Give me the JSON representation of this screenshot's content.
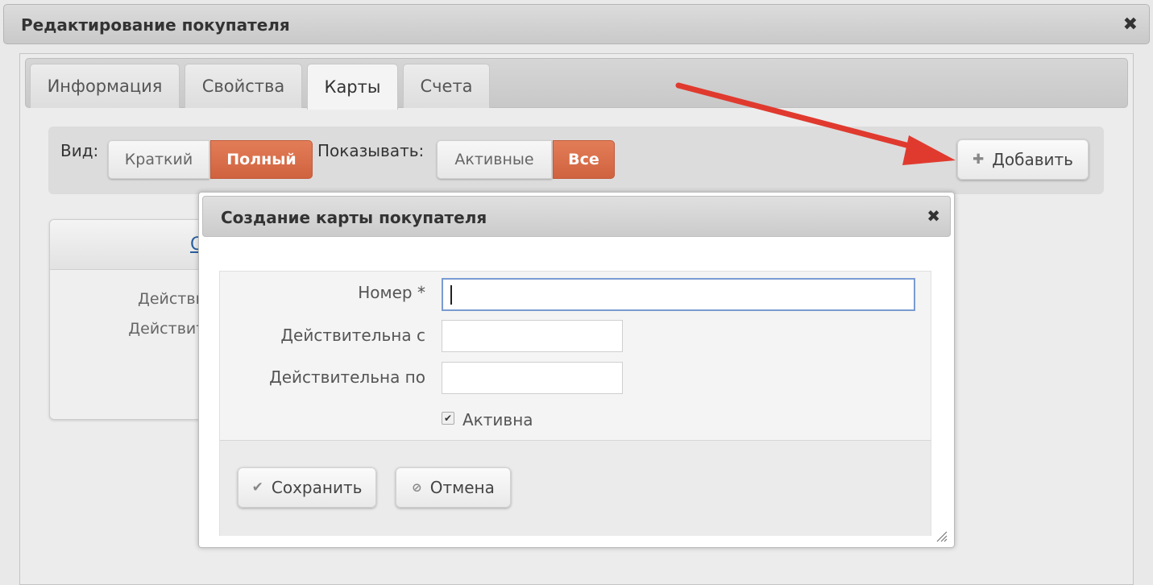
{
  "outer_dialog": {
    "title": "Редактирование покупателя",
    "close_glyph": "✖"
  },
  "tabs": [
    {
      "label": "Информация",
      "active": false
    },
    {
      "label": "Свойства",
      "active": false
    },
    {
      "label": "Карты",
      "active": true
    },
    {
      "label": "Счета",
      "active": false
    }
  ],
  "toolbar": {
    "view_label": "Вид:",
    "view_options": [
      {
        "label": "Краткий",
        "selected": false
      },
      {
        "label": "Полный",
        "selected": true
      }
    ],
    "show_label": "Показывать:",
    "show_options": [
      {
        "label": "Активные",
        "selected": false
      },
      {
        "label": "Все",
        "selected": true
      }
    ],
    "add_button": {
      "label": "Добавить",
      "icon": "plus-icon"
    }
  },
  "background_card": {
    "link_text": "С",
    "row1": "Действит",
    "row2": "Действите"
  },
  "modal": {
    "title": "Создание карты покупателя",
    "close_glyph": "✖",
    "fields": {
      "number": {
        "label": "Номер *",
        "value": ""
      },
      "valid_from": {
        "label": "Действительна с",
        "value": ""
      },
      "valid_to": {
        "label": "Действительна по",
        "value": ""
      }
    },
    "active_checkbox": {
      "label": "Активна",
      "checked": true
    },
    "save_button": {
      "label": "Сохранить",
      "icon": "check-icon"
    },
    "cancel_button": {
      "label": "Отмена",
      "icon": "cancel-icon"
    }
  },
  "colors": {
    "accent": "#d86a45",
    "annotation_arrow": "#e03a2f",
    "focus_border": "#7a9bd1"
  }
}
